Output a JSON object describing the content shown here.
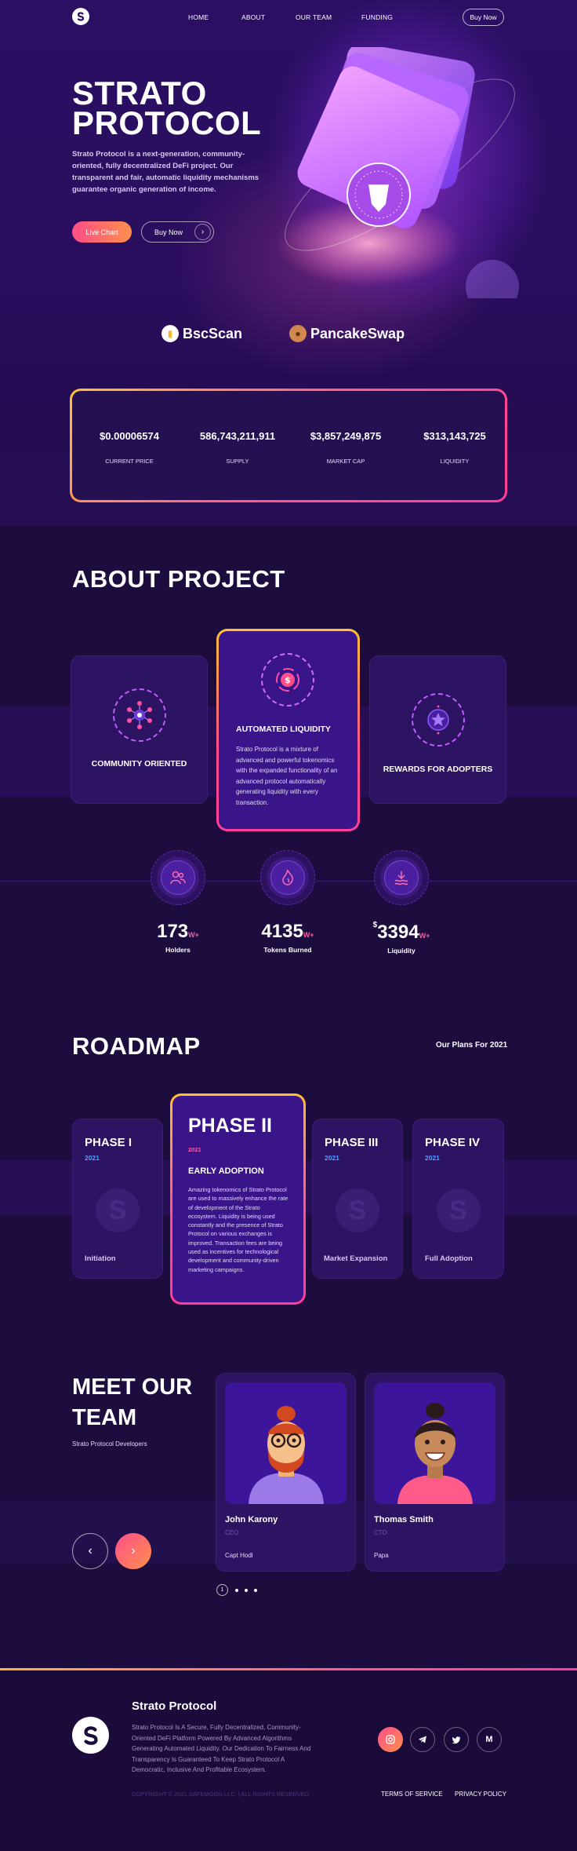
{
  "nav": {
    "links": [
      "HOME",
      "ABOUT",
      "OUR TEAM",
      "FUNDING"
    ],
    "buy_label": "Buy Now"
  },
  "hero": {
    "title_line1": "STRATO",
    "title_line2": "PROTOCOL",
    "description": "Strato Protocol is a next-generation, community-oriented, fully decentralized DeFi project. Our transparent and fair, automatic liquidity mechanisms guarantee organic generation of income.",
    "live_chart_label": "Live Chart",
    "buy_now_label": "Buy Now",
    "partners": [
      "BscScan",
      "PancakeSwap"
    ]
  },
  "stats": [
    {
      "value": "$0.00006574",
      "label": "CURRENT PRICE"
    },
    {
      "value": "586,743,211,911",
      "label": "SUPPLY"
    },
    {
      "value": "$3,857,249,875",
      "label": "MARKET CAP"
    },
    {
      "value": "$313,143,725",
      "label": "LIQUIDITY"
    }
  ],
  "about": {
    "title": "ABOUT  PROJECT",
    "cards": [
      {
        "title": "COMMUNITY ORIENTED",
        "icon": "network-icon"
      },
      {
        "title": "AUTOMATED LIQUIDITY",
        "icon": "dollar-coin-icon",
        "text": "Strato Protocol is a mixture of advanced and powerful tokenomics with the expanded functionality of an advanced protocol automatically generating liquidity with every transaction."
      },
      {
        "title": "REWARDS FOR ADOPTERS",
        "icon": "star-badge-icon"
      }
    ],
    "counters": [
      {
        "value": "173",
        "prefix": "",
        "suffix": "W+",
        "label": "Holders",
        "icon": "users-icon"
      },
      {
        "value": "4135",
        "prefix": "",
        "suffix": "W+",
        "label": "Tokens Burned",
        "icon": "flame-icon"
      },
      {
        "value": "3394",
        "prefix": "$",
        "suffix": "W+",
        "label": "Liquidity",
        "icon": "water-icon"
      }
    ]
  },
  "roadmap": {
    "title": "ROADMAP",
    "subtitle": "Our Plans For 2021",
    "phases": [
      {
        "phase": "PHASE I",
        "year": "2021",
        "name": "Initiation"
      },
      {
        "phase": "PHASE II",
        "year": "2021",
        "heading": "EARLY ADOPTION",
        "text": "Amazing tokenomics of Strato Protocol are used to massively enhance the rate of development of the Strato ecosystem. Liquidity is being used constantly and the presence of Strato Protocol on various exchanges is improved. Transaction fees are being used as incentives for technological development and community-driven marketing campaigns."
      },
      {
        "phase": "PHASE III",
        "year": "2021",
        "name": "Market  Expansion"
      },
      {
        "phase": "PHASE IV",
        "year": "2021",
        "name": "Full Adoption"
      }
    ]
  },
  "team": {
    "title_line1": "MEET OUR",
    "title_line2": "TEAM",
    "subtitle": "Strato Protocol Developers",
    "members": [
      {
        "name": "John Karony",
        "role": "CEO",
        "company": "Capt Hodl"
      },
      {
        "name": "Thomas Smith",
        "role": "CTO",
        "company": "Papa"
      }
    ],
    "dots_active": "1"
  },
  "footer": {
    "brand": "Strato Protocol",
    "description": "Strato Protocol Is A Secure, Fully Decentralized, Community-Oriented DeFi Platform Powered By Advanced Algorithms Generating Automated Liquidity. Our Dedication To Fairness And Transparency Is Guaranteed To Keep Strato Protocol A Democratic, Inclusive And Profitable Ecosystem.",
    "copyright": "COPYRIGHT © 2021 SAFEMOON LLC. | ALL RIGHTS RESERVED",
    "links": [
      "TERMS OF SERVICE",
      "PRIVACY POLICY"
    ],
    "socials": [
      "instagram-icon",
      "telegram-icon",
      "twitter-icon",
      "medium-icon"
    ],
    "colors": {
      "accent_pink": "#ff4e8a",
      "accent_orange": "#ff8f4c",
      "accent_yellow": "#ffc233",
      "background": "#1d0c3e"
    }
  }
}
